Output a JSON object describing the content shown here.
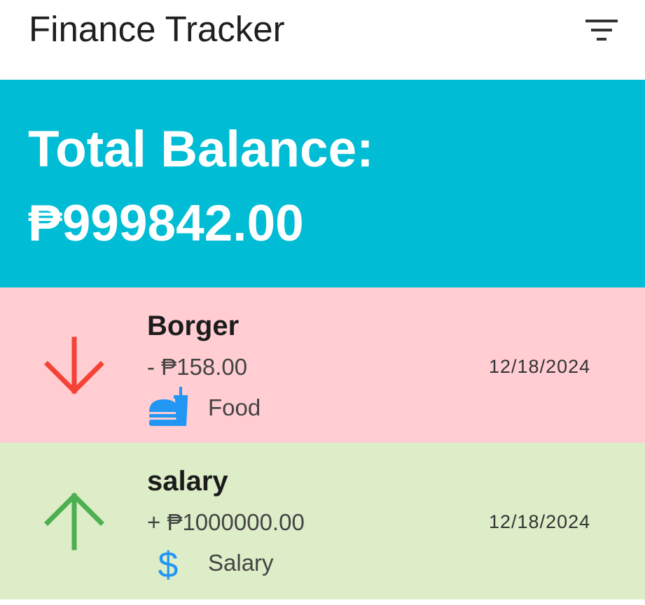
{
  "app": {
    "title": "Finance Tracker",
    "filter_icon": "filter-list-icon"
  },
  "balance": {
    "label": "Total Balance:",
    "value": "₱999842.00",
    "color": "#00bcd4"
  },
  "transactions": [
    {
      "title": "Borger",
      "amount": "- ₱158.00",
      "type": "expense",
      "direction_icon": "arrow-down-icon",
      "category": "Food",
      "category_icon": "fastfood-icon",
      "date": "12/18/2024",
      "background": "#ffcdd2",
      "arrow_color": "#f44336"
    },
    {
      "title": "salary",
      "amount": "+ ₱1000000.00",
      "type": "income",
      "direction_icon": "arrow-up-icon",
      "category": "Salary",
      "category_icon": "dollar-icon",
      "date": "12/18/2024",
      "background": "#dcedc8",
      "arrow_color": "#4caf50"
    }
  ],
  "colors": {
    "category_icon": "#2196f3"
  }
}
